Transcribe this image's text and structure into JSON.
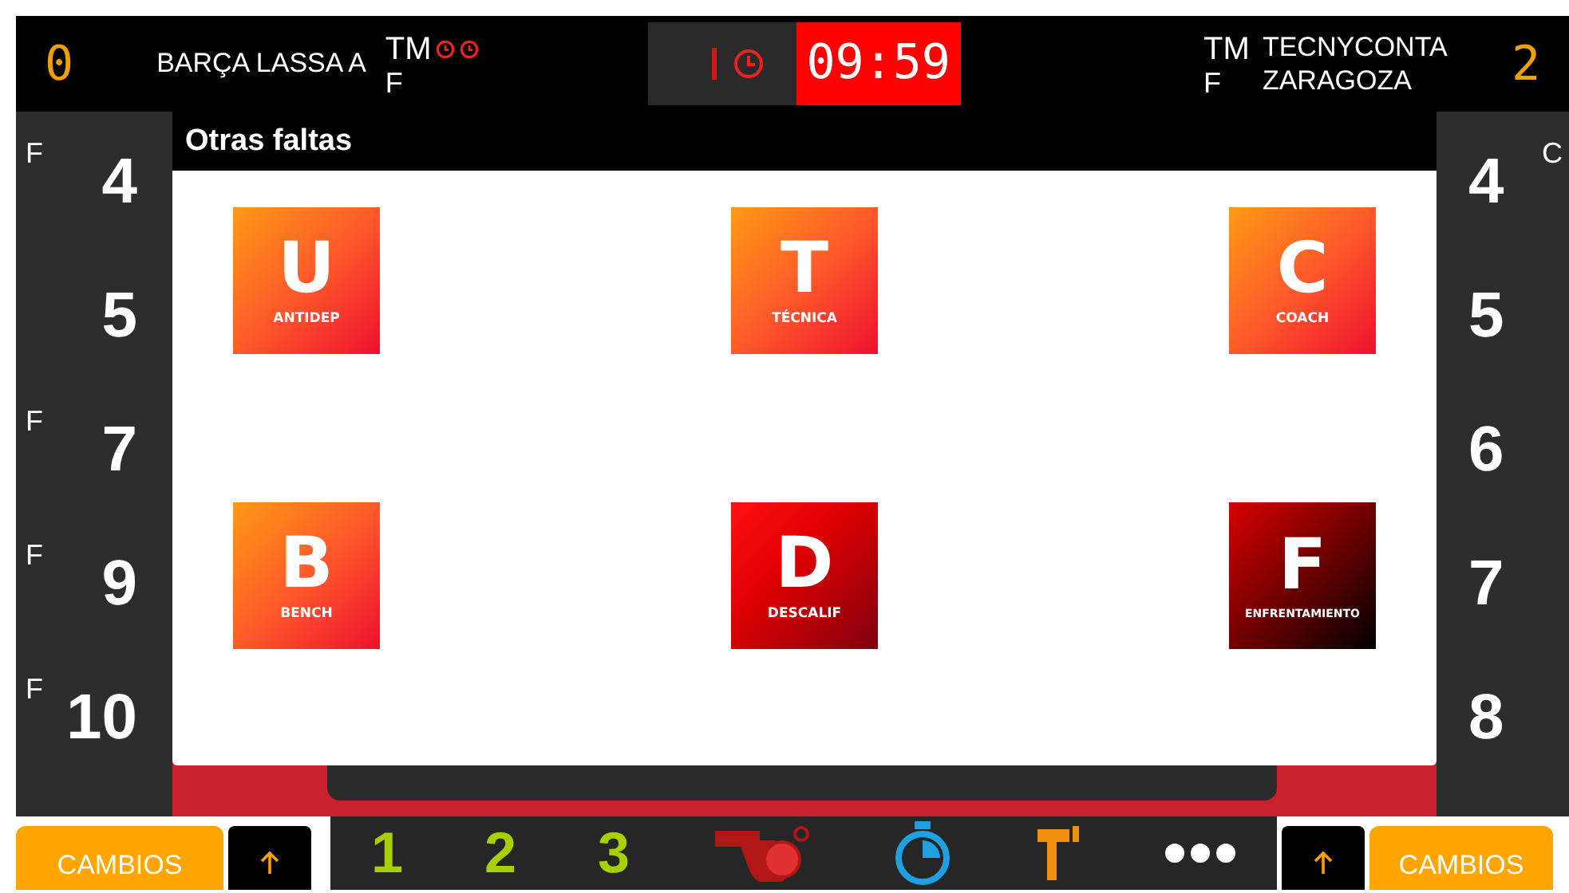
{
  "scoreboard": {
    "home": {
      "score": "0",
      "name": "BARÇA LASSA A",
      "timeout_label": "TM",
      "timeout_marks": [
        {
          "used": true
        },
        {
          "used": true
        }
      ],
      "fouls_label": "F"
    },
    "clock": {
      "time": "09:59"
    },
    "away": {
      "timeout_label": "TM",
      "fouls_label": "F",
      "name": "TECNYCONTA ZARAGOZA",
      "score": "2"
    }
  },
  "home_players": [
    {
      "flag": "F",
      "number": "4"
    },
    {
      "number": "5"
    },
    {
      "flag": "F",
      "number": "7"
    },
    {
      "flag": "F",
      "number": "9"
    },
    {
      "flag": "F",
      "number": "10"
    }
  ],
  "away_players": [
    {
      "number": "4",
      "flag": "C"
    },
    {
      "number": "5"
    },
    {
      "number": "6"
    },
    {
      "number": "7"
    },
    {
      "number": "8"
    }
  ],
  "dialog": {
    "title": "Otras faltas",
    "options": [
      {
        "letter": "U",
        "label": "ANTIDEP",
        "kind": "standard"
      },
      {
        "letter": "T",
        "label": "TÉCNICA",
        "kind": "standard"
      },
      {
        "letter": "C",
        "label": "COACH",
        "kind": "standard"
      },
      {
        "letter": "B",
        "label": "BENCH",
        "kind": "standard"
      },
      {
        "letter": "D",
        "label": "DESCALIF",
        "kind": "severe"
      },
      {
        "letter": "F",
        "label": "ENFRENTAMIENTO",
        "kind": "extreme"
      }
    ]
  },
  "toolbar": [
    {
      "kind": "digit",
      "text": "1"
    },
    {
      "kind": "digit",
      "text": "2"
    },
    {
      "kind": "digit",
      "text": "3"
    },
    {
      "kind": "whistle"
    },
    {
      "kind": "stopwatch"
    },
    {
      "kind": "hammer"
    },
    {
      "kind": "dots"
    }
  ],
  "bottom": {
    "left_button": "CAMBIOS",
    "right_button": "CAMBIOS"
  }
}
